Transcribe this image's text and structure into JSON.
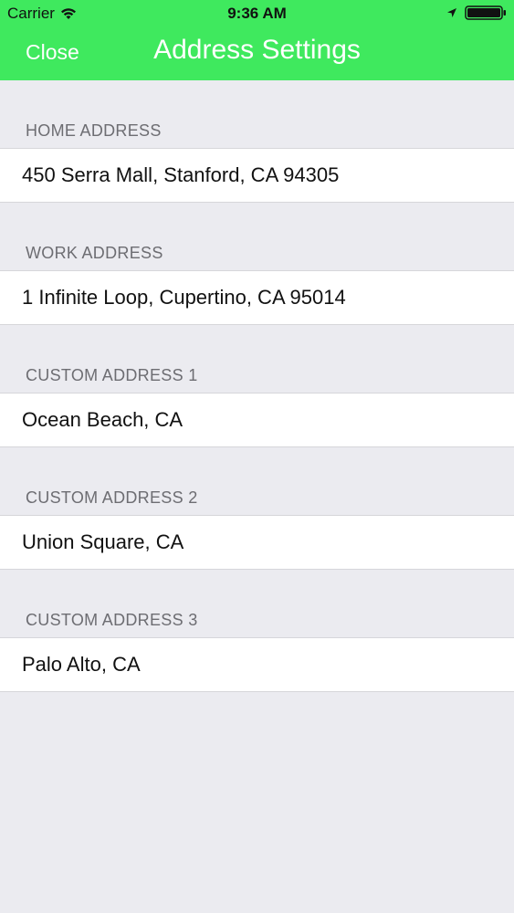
{
  "status_bar": {
    "carrier": "Carrier",
    "time": "9:36 AM"
  },
  "navbar": {
    "close_label": "Close",
    "title": "Address Settings",
    "background_color": "#3fe95e"
  },
  "sections": [
    {
      "header": "HOME ADDRESS",
      "value": "450 Serra Mall, Stanford, CA 94305"
    },
    {
      "header": "WORK ADDRESS",
      "value": "1 Infinite Loop, Cupertino, CA 95014"
    },
    {
      "header": "CUSTOM ADDRESS 1",
      "value": "Ocean Beach, CA"
    },
    {
      "header": "CUSTOM ADDRESS 2",
      "value": "Union Square, CA"
    },
    {
      "header": "CUSTOM ADDRESS 3",
      "value": "Palo Alto, CA"
    }
  ]
}
